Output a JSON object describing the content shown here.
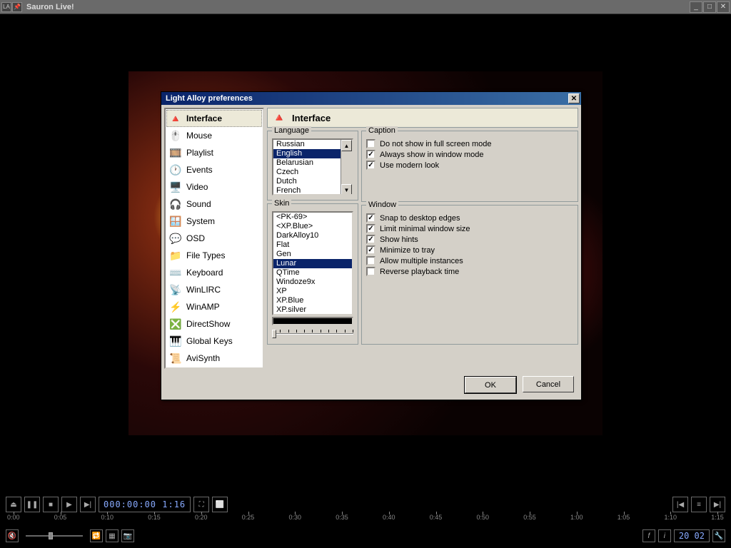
{
  "window": {
    "title": "Sauron Live!"
  },
  "player": {
    "time": "000:00:00 1:16",
    "seek_labels": [
      "0:00",
      "0:05",
      "0:10",
      "0:15",
      "0:20",
      "0:25",
      "0:30",
      "0:35",
      "0:40",
      "0:45",
      "0:50",
      "0:55",
      "1:00",
      "1:05",
      "1:10",
      "1:15"
    ],
    "duration": "20 02"
  },
  "dialog": {
    "title": "Light Alloy preferences",
    "categories": [
      "Interface",
      "Mouse",
      "Playlist",
      "Events",
      "Video",
      "Sound",
      "System",
      "OSD",
      "File Types",
      "Keyboard",
      "WinLIRC",
      "WinAMP",
      "DirectShow",
      "Global Keys",
      "AviSynth"
    ],
    "selected_category": "Interface",
    "panel_title": "Interface",
    "language": {
      "label": "Language",
      "items": [
        "Russian",
        "English",
        "Belarusian",
        "Czech",
        "Dutch",
        "French"
      ],
      "selected": "English"
    },
    "skin": {
      "label": "Skin",
      "items": [
        "<PK-69>",
        "<XP.Blue>",
        "DarkAlloy10",
        "Flat",
        "Gen",
        "Lunar",
        "QTime",
        "Windoze9x",
        "XP",
        "XP.Blue",
        "XP.silver"
      ],
      "selected": "Lunar"
    },
    "caption": {
      "label": "Caption",
      "items": [
        {
          "label": "Do not show in full screen mode",
          "checked": false
        },
        {
          "label": "Always show in window mode",
          "checked": true
        },
        {
          "label": "Use modern look",
          "checked": true
        }
      ]
    },
    "window_opts": {
      "label": "Window",
      "items": [
        {
          "label": "Snap to desktop edges",
          "checked": true
        },
        {
          "label": "Limit minimal window size",
          "checked": true
        },
        {
          "label": "Show hints",
          "checked": true
        },
        {
          "label": "Minimize to tray",
          "checked": true
        },
        {
          "label": "Allow multiple instances",
          "checked": false
        },
        {
          "label": "Reverse playback time",
          "checked": false
        }
      ]
    },
    "buttons": {
      "ok": "OK",
      "cancel": "Cancel"
    }
  }
}
